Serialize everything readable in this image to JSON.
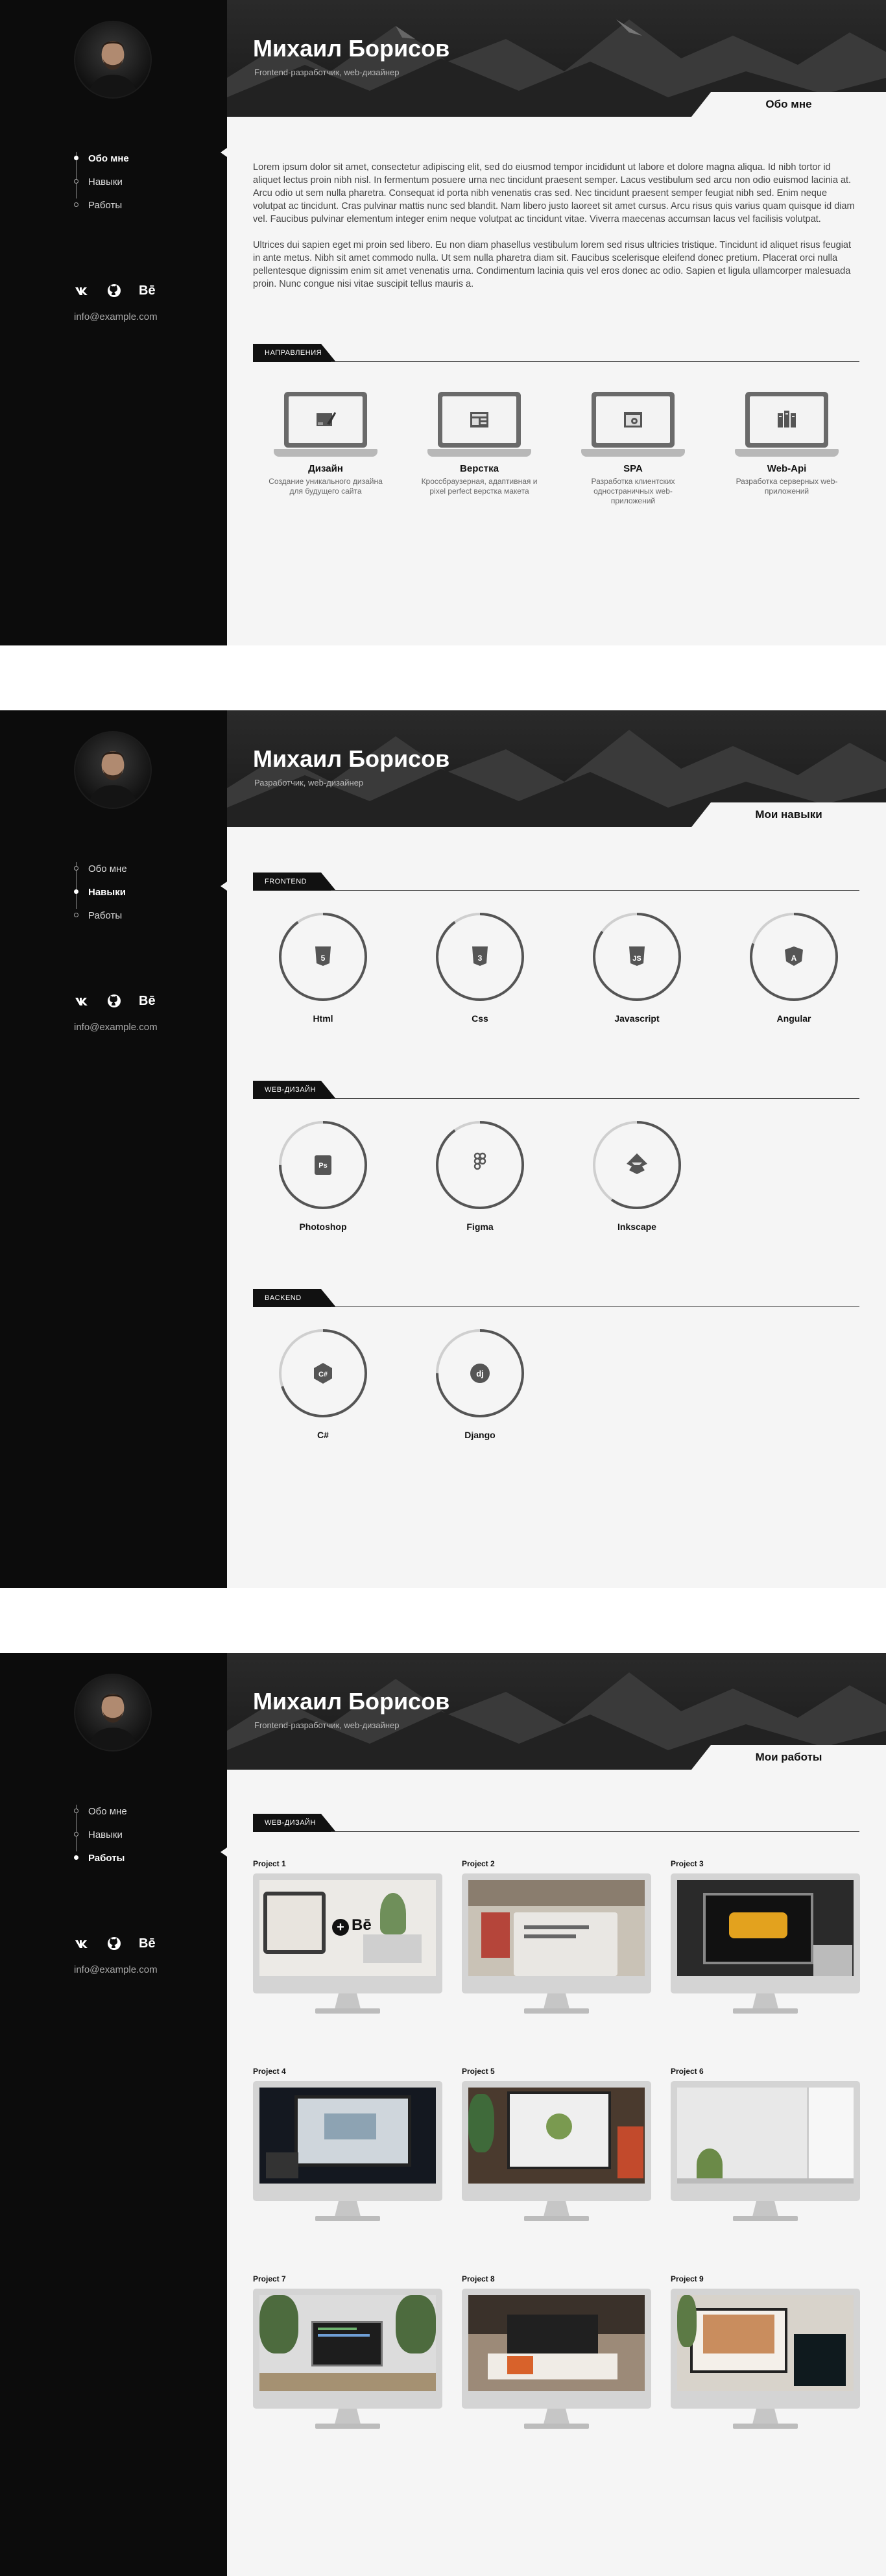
{
  "profile": {
    "name": "Михаил Борисов",
    "subtitle_1": "Frontend-разработчик, web-дизайнер",
    "subtitle_2": "Разработчик, web-дизайнер",
    "email": "info@example.com"
  },
  "nav": [
    {
      "label": "Обо мне"
    },
    {
      "label": "Навыки"
    },
    {
      "label": "Работы"
    }
  ],
  "socials": [
    {
      "label": "vk",
      "icon": "vk-icon"
    },
    {
      "label": "github",
      "icon": "github-icon"
    },
    {
      "label": "Bē",
      "icon": "behance-icon"
    }
  ],
  "screens": {
    "about": {
      "tab": "Обо мне",
      "paragraph_1": "Lorem ipsum dolor sit amet, consectetur adipiscing elit, sed do eiusmod tempor incididunt ut labore et dolore magna aliqua. Id nibh tortor id aliquet lectus proin nibh nisl. In fermentum posuere urna nec tincidunt praesent semper. Lacus vestibulum sed arcu non odio euismod lacinia at. Arcu odio ut sem nulla pharetra. Consequat id porta nibh venenatis cras sed. Nec tincidunt praesent semper feugiat nibh sed. Enim neque volutpat ac tincidunt. Cras pulvinar mattis nunc sed blandit. Nam libero justo laoreet sit amet cursus. Arcu risus quis varius quam quisque id diam vel. Faucibus pulvinar elementum integer enim neque volutpat ac tincidunt vitae. Viverra maecenas accumsan lacus vel facilisis volutpat.",
      "paragraph_2": "Ultrices dui sapien eget mi proin sed libero. Eu non diam phasellus vestibulum lorem sed risus ultricies tristique. Tincidunt id aliquet risus feugiat in ante metus. Nibh sit amet commodo nulla. Ut sem nulla pharetra diam sit. Faucibus scelerisque eleifend donec pretium. Placerat orci nulla pellentesque dignissim enim sit amet venenatis urna. Condimentum lacinia quis vel eros donec ac odio. Sapien et ligula ullamcorper malesuada proin. Nunc congue nisi vitae suscipit tellus mauris a.",
      "section_label": "НАПРАВЛЕНИЯ",
      "directions": [
        {
          "title": "Дизайн",
          "desc": "Создание уникального дизайна для будущего сайта",
          "icon": "design-icon"
        },
        {
          "title": "Верстка",
          "desc": "Кроссбраузерная, адаптивная и pixel perfect верстка макета",
          "icon": "layout-icon"
        },
        {
          "title": "SPA",
          "desc": "Разработка клиентских одностраничных web-приложений",
          "icon": "spa-icon"
        },
        {
          "title": "Web-Api",
          "desc": "Разработка серверных web-приложений",
          "icon": "server-icon"
        }
      ]
    },
    "skills": {
      "tab": "Мои навыки",
      "groups": [
        {
          "label": "FRONTEND",
          "items": [
            {
              "name": "Html",
              "icon": "html5-icon",
              "level": 0.9
            },
            {
              "name": "Css",
              "icon": "css3-icon",
              "level": 0.9
            },
            {
              "name": "Javascript",
              "icon": "javascript-icon",
              "level": 0.85
            },
            {
              "name": "Angular",
              "icon": "angular-icon",
              "level": 0.8
            }
          ]
        },
        {
          "label": "WEB-ДИЗАЙН",
          "items": [
            {
              "name": "Photoshop",
              "icon": "photoshop-icon",
              "level": 0.75
            },
            {
              "name": "Figma",
              "icon": "figma-icon",
              "level": 0.9
            },
            {
              "name": "Inkscape",
              "icon": "inkscape-icon",
              "level": 0.6
            }
          ]
        },
        {
          "label": "BACKEND",
          "items": [
            {
              "name": "C#",
              "icon": "csharp-icon",
              "level": 0.7
            },
            {
              "name": "Django",
              "icon": "django-icon",
              "level": 0.75
            }
          ]
        }
      ]
    },
    "works": {
      "tab": "Мои работы",
      "section_label": "WEB-ДИЗАЙН",
      "projects": [
        {
          "title": "Project 1"
        },
        {
          "title": "Project 2"
        },
        {
          "title": "Project 3"
        },
        {
          "title": "Project 4"
        },
        {
          "title": "Project 5"
        },
        {
          "title": "Project 6"
        },
        {
          "title": "Project 7"
        },
        {
          "title": "Project 8"
        },
        {
          "title": "Project 9"
        }
      ]
    }
  },
  "colors": {
    "sidebar": "#0c0c0c",
    "content": "#f5f5f5",
    "accent": "#111111",
    "ring_track": "#cfcfcf",
    "ring_fill": "#555555"
  }
}
